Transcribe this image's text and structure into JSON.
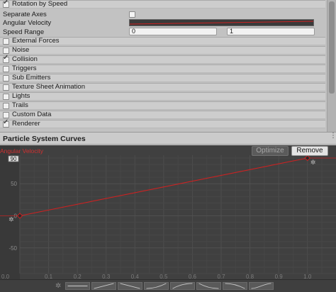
{
  "inspector": {
    "rotation_by_speed": {
      "label": "Rotation by Speed",
      "checked": true
    },
    "separate_axes": {
      "label": "Separate Axes",
      "checked": false
    },
    "angular_velocity": {
      "label": "Angular Velocity"
    },
    "speed_range": {
      "label": "Speed Range",
      "min": "0",
      "max": "1"
    },
    "modules": [
      {
        "label": "External Forces",
        "checked": false
      },
      {
        "label": "Noise",
        "checked": false
      },
      {
        "label": "Collision",
        "checked": true
      },
      {
        "label": "Triggers",
        "checked": false
      },
      {
        "label": "Sub Emitters",
        "checked": false
      },
      {
        "label": "Texture Sheet Animation",
        "checked": false
      },
      {
        "label": "Lights",
        "checked": false
      },
      {
        "label": "Trails",
        "checked": false
      },
      {
        "label": "Custom Data",
        "checked": false
      },
      {
        "label": "Renderer",
        "checked": true
      }
    ]
  },
  "curves_panel": {
    "title": "Particle System Curves",
    "optimize_label": "Optimize",
    "remove_label": "Remove",
    "curve_name": "Angular Velocity",
    "max_value": "90",
    "curve_color": "#cc2222"
  },
  "chart_data": {
    "type": "line",
    "title": "",
    "xlabel": "",
    "ylabel": "",
    "xlim": [
      0.0,
      1.05
    ],
    "ylim": [
      -90,
      90
    ],
    "x_ticks": [
      "0.0",
      "0.1",
      "0.2",
      "0.3",
      "0.4",
      "0.5",
      "0.6",
      "0.7",
      "0.8",
      "0.9",
      "1.0"
    ],
    "y_ticks": [
      "50",
      "0",
      "-50"
    ],
    "series": [
      {
        "x": [
          0.0,
          1.0
        ],
        "values": [
          0,
          90
        ],
        "color": "#cc2222"
      }
    ]
  },
  "presets": {
    "count": 8
  }
}
